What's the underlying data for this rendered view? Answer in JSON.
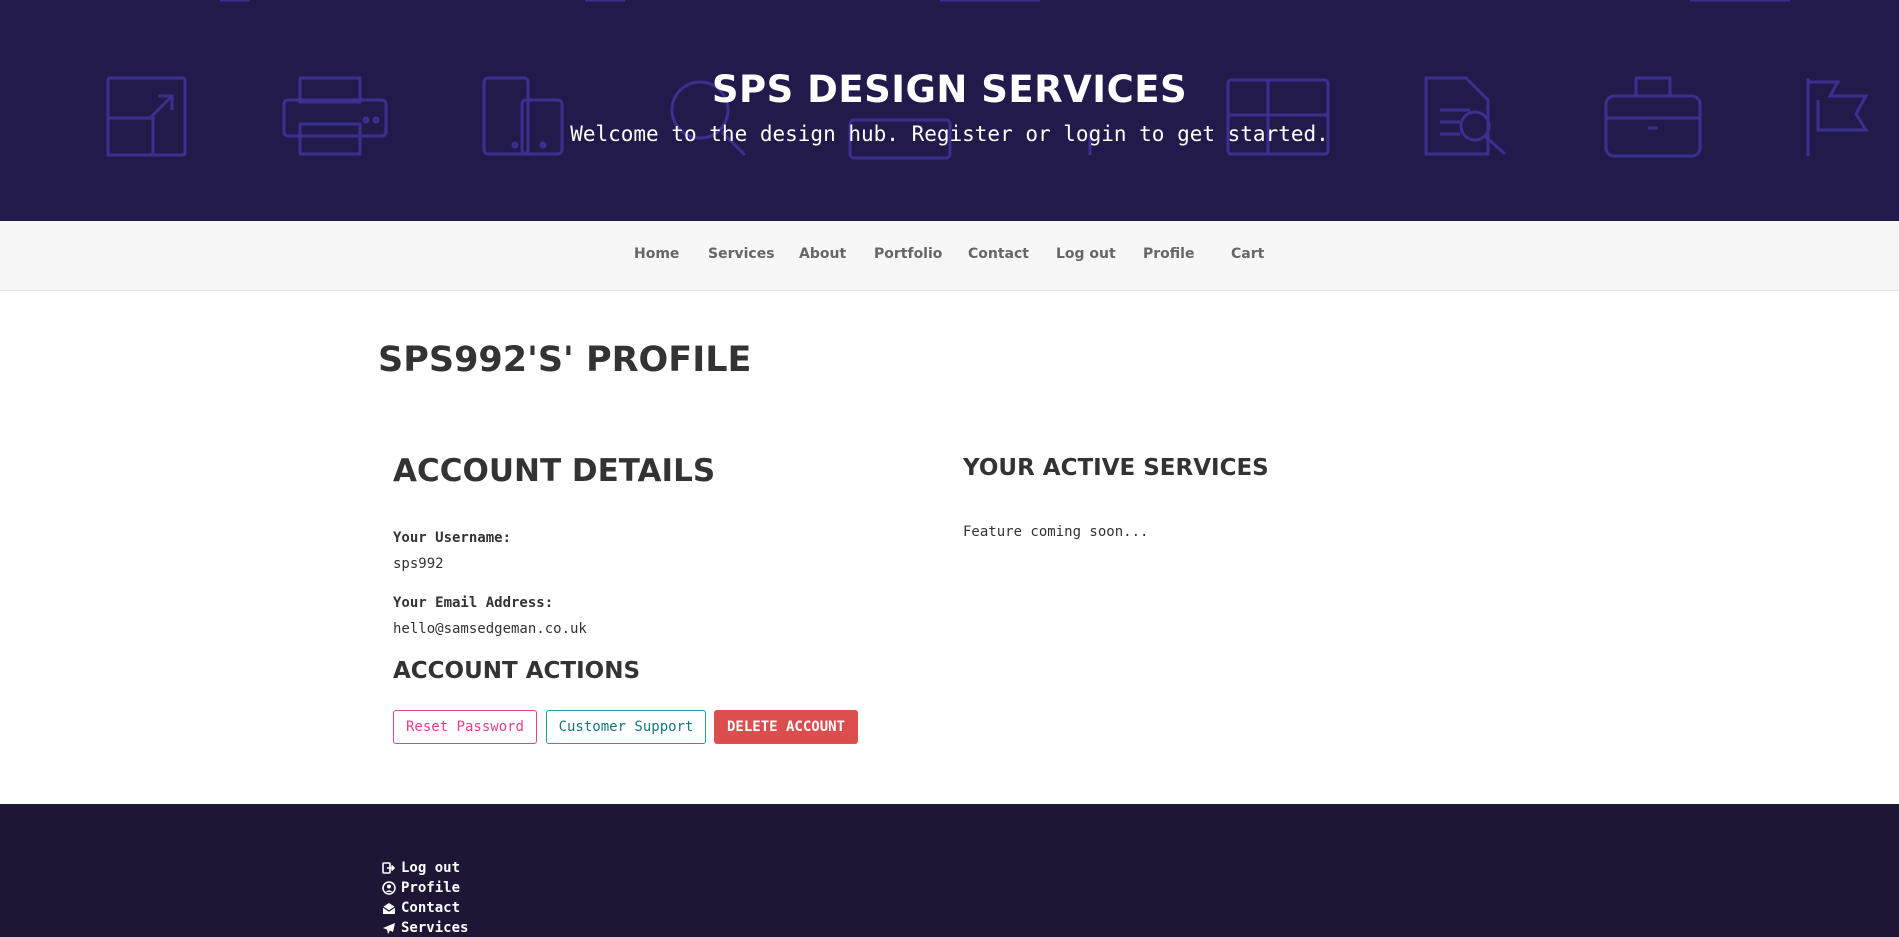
{
  "header": {
    "title": "SPS DESIGN SERVICES",
    "subtitle": "Welcome to the design hub. Register or login to get started."
  },
  "nav": {
    "items": [
      {
        "label": "Home"
      },
      {
        "label": "Services"
      },
      {
        "label": "About"
      },
      {
        "label": "Portfolio"
      },
      {
        "label": "Contact"
      },
      {
        "label": "Log out"
      },
      {
        "label": "Profile"
      },
      {
        "label": "Cart"
      }
    ]
  },
  "profile": {
    "page_title": "SPS992'S' PROFILE",
    "account_details": {
      "heading": "ACCOUNT DETAILS",
      "username_label": "Your Username:",
      "username_value": "sps992",
      "email_label": "Your Email Address:",
      "email_value": "hello@samsedgeman.co.uk"
    },
    "active_services": {
      "heading": "YOUR ACTIVE SERVICES",
      "message": "Feature coming soon..."
    },
    "account_actions": {
      "heading": "ACCOUNT ACTIONS",
      "reset_label": "Reset Password",
      "support_label": "Customer Support",
      "delete_label": "DELETE ACCOUNT"
    }
  },
  "footer": {
    "links": [
      {
        "label": "Log out",
        "icon": "logout-icon"
      },
      {
        "label": "Profile",
        "icon": "user-circle-icon"
      },
      {
        "label": "Contact",
        "icon": "envelope-open-icon"
      },
      {
        "label": "Services",
        "icon": "paper-plane-icon"
      }
    ]
  },
  "colors": {
    "header_bg": "#221a4b",
    "header_icons": "#3a2f8a",
    "footer_bg": "#1d1635",
    "reset": "#e83e8c",
    "support": "#17a2a0",
    "delete": "#dc4d4d"
  }
}
